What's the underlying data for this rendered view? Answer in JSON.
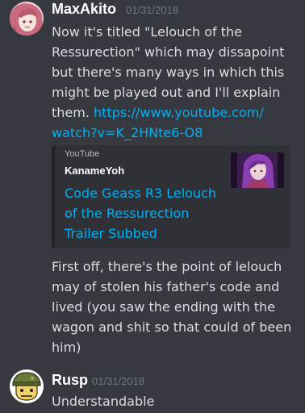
{
  "messages": [
    {
      "author": "MaxAkito",
      "timestamp": "01/31/2018",
      "avatar_icon": "anime-girl-avatar-icon",
      "lines": [
        "Now it's titled \"Lelouch of the",
        "Ressurection\" which may dissapoint",
        "but there's many ways in which this",
        "might be played out and I'll explain",
        "them."
      ],
      "link_part1": "https://www.youtube.com/",
      "link_part2": "watch?v=K_2HNte6-O8",
      "embed": {
        "provider": "YouTube",
        "author": "KanameYoh",
        "title_lines": [
          "Code Geass R3 Lelouch",
          "of the Ressurection",
          "Trailer Subbed"
        ],
        "thumbnail_icon": "video-thumbnail-icon"
      },
      "followup_lines": [
        "First off, there's the point of lelouch",
        "may of stolen his father's code and",
        "lived (you saw the ending with the",
        "wagon and shit so that could of been",
        "him)"
      ]
    },
    {
      "author": "Rusp",
      "timestamp": "01/31/2018",
      "avatar_icon": "cartoon-soldier-avatar-icon",
      "lines": [
        "Understandable"
      ]
    }
  ],
  "colors": {
    "background": "#36393f",
    "embed_background": "#2f3136",
    "link": "#00b0f4",
    "timestamp": "#72767d",
    "text": "#dcddde"
  }
}
